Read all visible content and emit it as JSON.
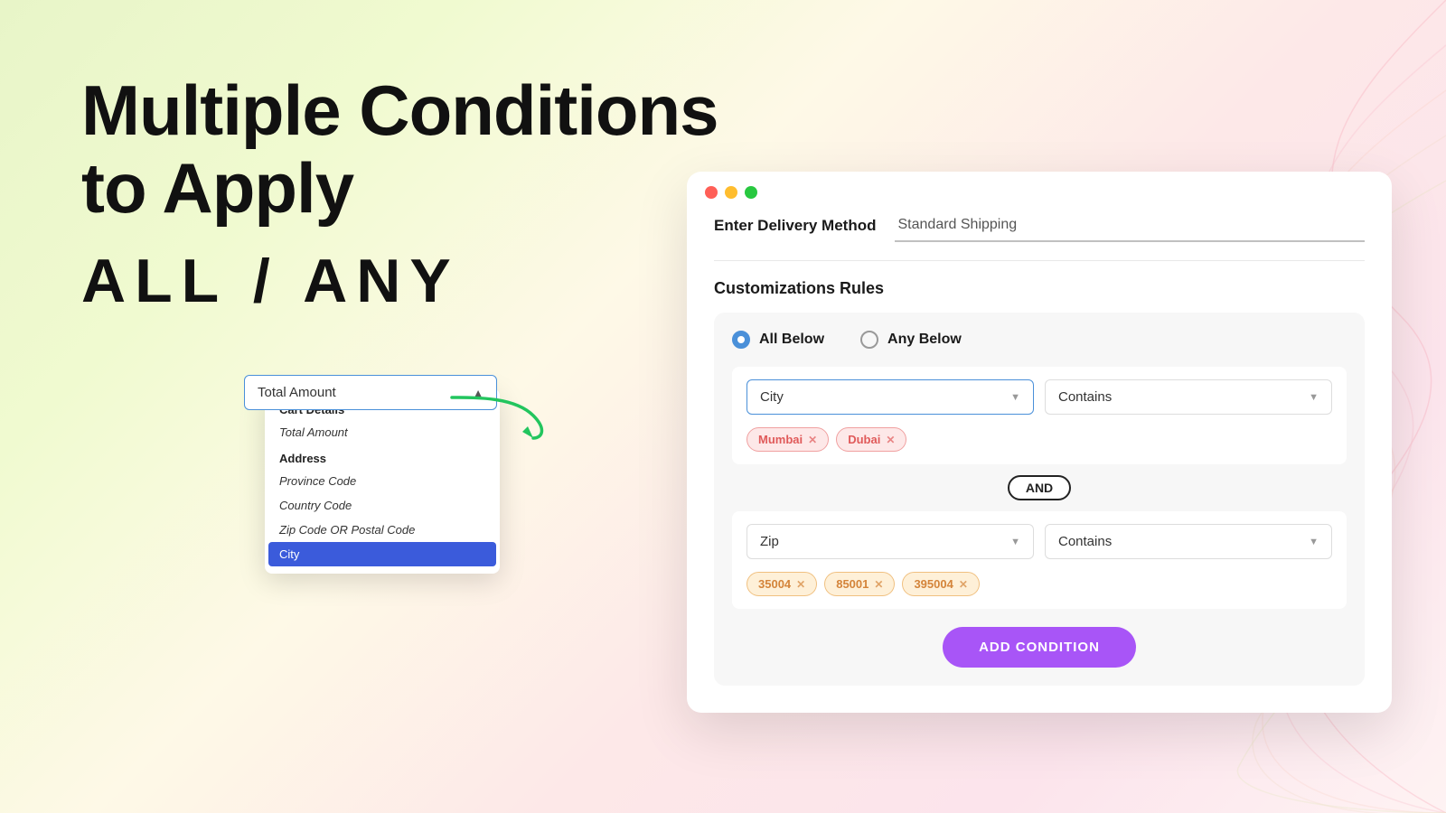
{
  "background": {
    "colors": [
      "#e8f5c8",
      "#f0fad0",
      "#fef9e7",
      "#fde8e8",
      "#fce4ec"
    ]
  },
  "left_heading": {
    "line1": "Multiple Conditions",
    "line2": "to Apply",
    "line3": "ALL / ANY"
  },
  "dropdown": {
    "trigger_label": "Total Amount",
    "sections": [
      {
        "title": "Cart Details",
        "items": [
          {
            "label": "Total Amount",
            "selected": false
          }
        ]
      },
      {
        "title": "Address",
        "items": [
          {
            "label": "Province Code",
            "selected": false
          },
          {
            "label": "Country Code",
            "selected": false
          },
          {
            "label": "Zip Code OR Postal Code",
            "selected": false
          },
          {
            "label": "City",
            "selected": true
          }
        ]
      }
    ]
  },
  "card": {
    "window_buttons": [
      "red",
      "yellow",
      "green"
    ],
    "delivery_section": {
      "label": "Enter Delivery Method",
      "input_value": "Standard Shipping"
    },
    "rules_title": "Customizations Rules",
    "toggle": {
      "all_below_label": "All Below",
      "any_below_label": "Any Below",
      "selected": "all"
    },
    "conditions": [
      {
        "field": "City",
        "operator": "Contains",
        "tags": [
          {
            "label": "Mumbai",
            "style": "pink"
          },
          {
            "label": "Dubai",
            "style": "pink"
          }
        ]
      },
      {
        "and_separator": "AND"
      },
      {
        "field": "Zip",
        "operator": "Contains",
        "tags": [
          {
            "label": "35004",
            "style": "orange"
          },
          {
            "label": "85001",
            "style": "orange"
          },
          {
            "label": "395004",
            "style": "orange"
          }
        ]
      }
    ],
    "add_condition_button": "ADD CONDITION"
  }
}
